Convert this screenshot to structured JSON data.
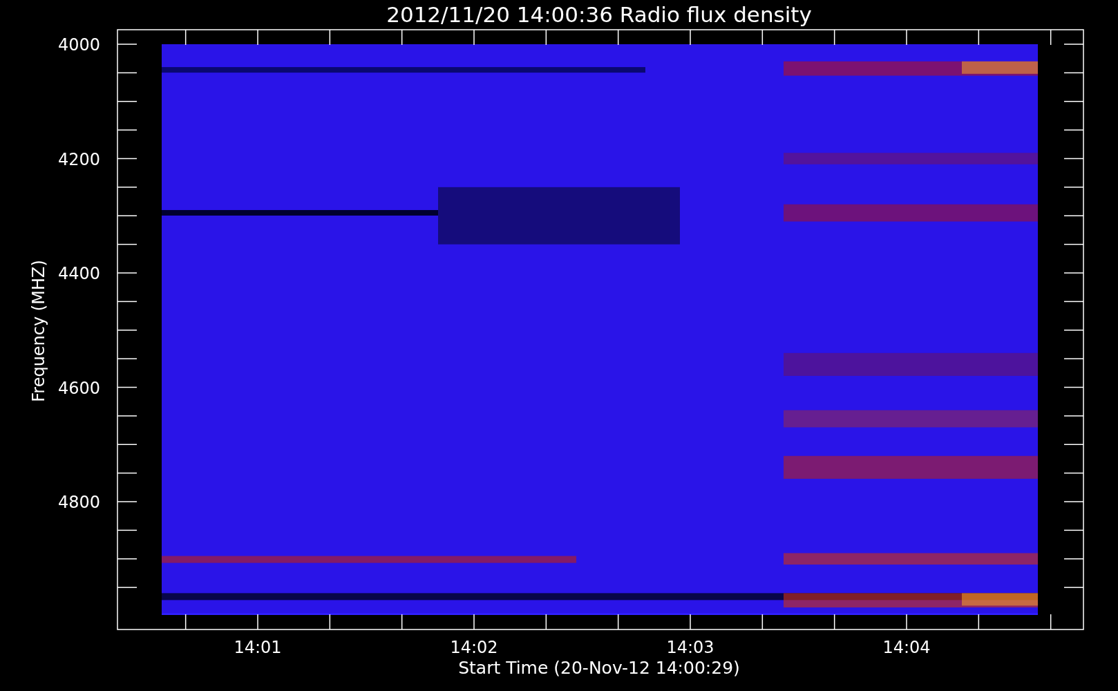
{
  "title": "2012/11/20 14:00:36 Radio flux density",
  "y_axis": {
    "label": "Frequency (MHZ)",
    "ticks": [
      "4000",
      "4200",
      "4400",
      "4600",
      "4800"
    ]
  },
  "x_axis": {
    "label": "Start Time (20-Nov-12 14:00:29)",
    "ticks": [
      "14:01",
      "14:02",
      "14:03",
      "14:04"
    ]
  }
}
